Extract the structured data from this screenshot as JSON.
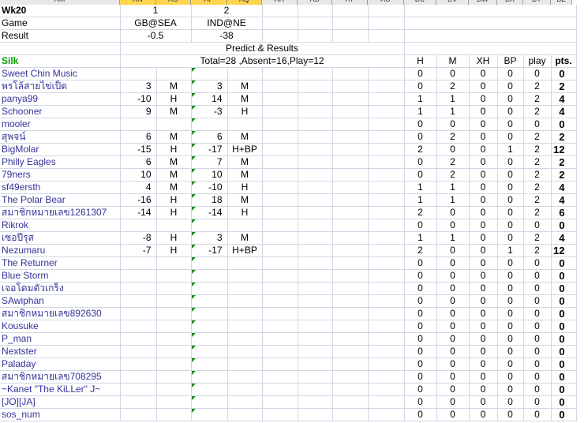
{
  "columns": [
    "AM",
    "AN",
    "AO",
    "AP",
    "AQ",
    "AR",
    "AS",
    "AT",
    "AU",
    "BU",
    "BV",
    "BW",
    "BX",
    "BY",
    "BZ"
  ],
  "header": {
    "week_label": "Wk20",
    "game_label": "Game",
    "result_label": "Result",
    "game_numbers": [
      "1",
      "2"
    ],
    "games": [
      "GB@SEA",
      "IND@NE"
    ],
    "results": [
      "-0.5",
      "-38"
    ],
    "predict_title": "Predict & Results",
    "group_name": "Silk",
    "summary": "Total=28 ,Absent=16,Play=12",
    "stat_headers": [
      "H",
      "M",
      "XH",
      "BP",
      "play",
      "pts."
    ]
  },
  "rows": [
    {
      "name": "Sweet Chin Music",
      "p1": "",
      "r1": "",
      "p2": "",
      "r2": "",
      "H": "0",
      "M": "0",
      "XH": "0",
      "BP": "0",
      "play": "0",
      "pts": "0"
    },
    {
      "name": "พรโล้สายไข่เป็ด",
      "p1": "3",
      "r1": "M",
      "p2": "3",
      "r2": "M",
      "H": "0",
      "M": "2",
      "XH": "0",
      "BP": "0",
      "play": "2",
      "pts": "2"
    },
    {
      "name": "panya99",
      "p1": "-10",
      "r1": "H",
      "p2": "14",
      "r2": "M",
      "H": "1",
      "M": "1",
      "XH": "0",
      "BP": "0",
      "play": "2",
      "pts": "4"
    },
    {
      "name": "Schooner",
      "p1": "9",
      "r1": "M",
      "p2": "-3",
      "r2": "H",
      "H": "1",
      "M": "1",
      "XH": "0",
      "BP": "0",
      "play": "2",
      "pts": "4"
    },
    {
      "name": "mooler",
      "p1": "",
      "r1": "",
      "p2": "",
      "r2": "",
      "H": "0",
      "M": "0",
      "XH": "0",
      "BP": "0",
      "play": "0",
      "pts": "0"
    },
    {
      "name": "สุพจน์",
      "p1": "6",
      "r1": "M",
      "p2": "6",
      "r2": "M",
      "H": "0",
      "M": "2",
      "XH": "0",
      "BP": "0",
      "play": "2",
      "pts": "2"
    },
    {
      "name": "BigMolar",
      "p1": "-15",
      "r1": "H",
      "p2": "-17",
      "r2": "H+BP",
      "H": "2",
      "M": "0",
      "XH": "0",
      "BP": "1",
      "play": "2",
      "pts": "12"
    },
    {
      "name": "Philly Eagles",
      "p1": "6",
      "r1": "M",
      "p2": "7",
      "r2": "M",
      "H": "0",
      "M": "2",
      "XH": "0",
      "BP": "0",
      "play": "2",
      "pts": "2"
    },
    {
      "name": "79ners",
      "p1": "10",
      "r1": "M",
      "p2": "10",
      "r2": "M",
      "H": "0",
      "M": "2",
      "XH": "0",
      "BP": "0",
      "play": "2",
      "pts": "2"
    },
    {
      "name": "sf49ersth",
      "p1": "4",
      "r1": "M",
      "p2": "-10",
      "r2": "H",
      "H": "1",
      "M": "1",
      "XH": "0",
      "BP": "0",
      "play": "2",
      "pts": "4"
    },
    {
      "name": "The Polar Bear",
      "p1": "-16",
      "r1": "H",
      "p2": "18",
      "r2": "M",
      "H": "1",
      "M": "1",
      "XH": "0",
      "BP": "0",
      "play": "2",
      "pts": "4"
    },
    {
      "name": "สมาชิกหมายเลข1261307",
      "p1": "-14",
      "r1": "H",
      "p2": "-14",
      "r2": "H",
      "H": "2",
      "M": "0",
      "XH": "0",
      "BP": "0",
      "play": "2",
      "pts": "6"
    },
    {
      "name": "Rikrok",
      "p1": "",
      "r1": "",
      "p2": "",
      "r2": "",
      "H": "0",
      "M": "0",
      "XH": "0",
      "BP": "0",
      "play": "0",
      "pts": "0"
    },
    {
      "name": "เซอปีรุส",
      "p1": "-8",
      "r1": "H",
      "p2": "3",
      "r2": "M",
      "H": "1",
      "M": "1",
      "XH": "0",
      "BP": "0",
      "play": "2",
      "pts": "4"
    },
    {
      "name": "Nezumaru",
      "p1": "-7",
      "r1": "H",
      "p2": "-17",
      "r2": "H+BP",
      "H": "2",
      "M": "0",
      "XH": "0",
      "BP": "1",
      "play": "2",
      "pts": "12"
    },
    {
      "name": "The Returner",
      "p1": "",
      "r1": "",
      "p2": "",
      "r2": "",
      "H": "0",
      "M": "0",
      "XH": "0",
      "BP": "0",
      "play": "0",
      "pts": "0"
    },
    {
      "name": "Blue Storm",
      "p1": "",
      "r1": "",
      "p2": "",
      "r2": "",
      "H": "0",
      "M": "0",
      "XH": "0",
      "BP": "0",
      "play": "0",
      "pts": "0"
    },
    {
      "name": "เจอโดมตัวเกร็ง",
      "p1": "",
      "r1": "",
      "p2": "",
      "r2": "",
      "H": "0",
      "M": "0",
      "XH": "0",
      "BP": "0",
      "play": "0",
      "pts": "0"
    },
    {
      "name": "SAwiphan",
      "p1": "",
      "r1": "",
      "p2": "",
      "r2": "",
      "H": "0",
      "M": "0",
      "XH": "0",
      "BP": "0",
      "play": "0",
      "pts": "0"
    },
    {
      "name": "สมาชิกหมายเลข892630",
      "p1": "",
      "r1": "",
      "p2": "",
      "r2": "",
      "H": "0",
      "M": "0",
      "XH": "0",
      "BP": "0",
      "play": "0",
      "pts": "0"
    },
    {
      "name": "Kousuke",
      "p1": "",
      "r1": "",
      "p2": "",
      "r2": "",
      "H": "0",
      "M": "0",
      "XH": "0",
      "BP": "0",
      "play": "0",
      "pts": "0"
    },
    {
      "name": "P_man",
      "p1": "",
      "r1": "",
      "p2": "",
      "r2": "",
      "H": "0",
      "M": "0",
      "XH": "0",
      "BP": "0",
      "play": "0",
      "pts": "0"
    },
    {
      "name": "Nextster",
      "p1": "",
      "r1": "",
      "p2": "",
      "r2": "",
      "H": "0",
      "M": "0",
      "XH": "0",
      "BP": "0",
      "play": "0",
      "pts": "0"
    },
    {
      "name": "Paladay",
      "p1": "",
      "r1": "",
      "p2": "",
      "r2": "",
      "H": "0",
      "M": "0",
      "XH": "0",
      "BP": "0",
      "play": "0",
      "pts": "0"
    },
    {
      "name": "สมาชิกหมายเลข708295",
      "p1": "",
      "r1": "",
      "p2": "",
      "r2": "",
      "H": "0",
      "M": "0",
      "XH": "0",
      "BP": "0",
      "play": "0",
      "pts": "0"
    },
    {
      "name": "~Kanet \"The KiLLer\" J~",
      "p1": "",
      "r1": "",
      "p2": "",
      "r2": "",
      "H": "0",
      "M": "0",
      "XH": "0",
      "BP": "0",
      "play": "0",
      "pts": "0"
    },
    {
      "name": "[JO][JA]",
      "p1": "",
      "r1": "",
      "p2": "",
      "r2": "",
      "H": "0",
      "M": "0",
      "XH": "0",
      "BP": "0",
      "play": "0",
      "pts": "0"
    },
    {
      "name": "sos_num",
      "p1": "",
      "r1": "",
      "p2": "",
      "r2": "",
      "H": "0",
      "M": "0",
      "XH": "0",
      "BP": "0",
      "play": "0",
      "pts": "0"
    }
  ]
}
